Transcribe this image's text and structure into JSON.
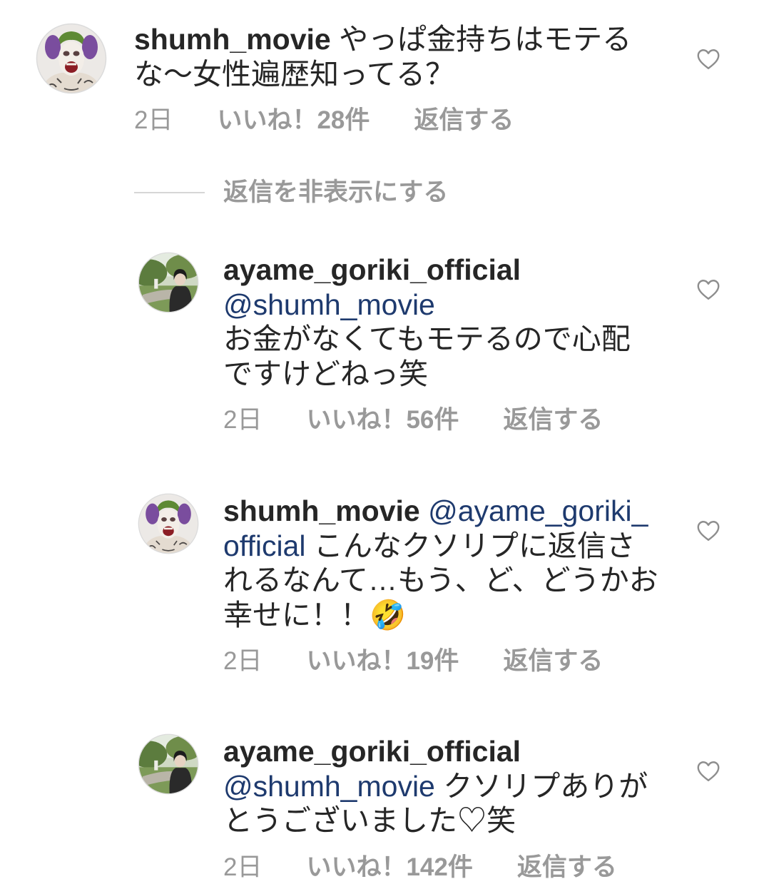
{
  "comment": {
    "username": "shumh_movie",
    "text": "やっぱ金持ちはモテるな〜女性遍歴知ってる？",
    "time": "2日",
    "likes": "いいね！28件",
    "reply_label": "返信する"
  },
  "hide_replies_label": "返信を非表示にする",
  "replies": [
    {
      "username": "ayame_goriki_official",
      "mention": "@shumh_movie",
      "text": "お金がなくてもモテるので心配ですけどねっ笑",
      "time": "2日",
      "likes": "いいね！56件",
      "reply_label": "返信する"
    },
    {
      "username": "shumh_movie",
      "mention": "@ayame_goriki_official",
      "text": "こんなクソリプに返信されるなんて…もう、ど、どうかお幸せに！！🤣",
      "time": "2日",
      "likes": "いいね！19件",
      "reply_label": "返信する"
    },
    {
      "username": "ayame_goriki_official",
      "mention": "@shumh_movie",
      "text": "クソリプありがとうございました♡笑",
      "time": "2日",
      "likes": "いいね！142件",
      "reply_label": "返信する"
    }
  ],
  "icons": {
    "like": "heart-outline-icon"
  },
  "colors": {
    "text": "#262626",
    "mention": "#1e3a6e",
    "meta": "#999999",
    "heart": "#8e8e8e",
    "divider": "#d6d6d6",
    "background": "#ffffff"
  }
}
